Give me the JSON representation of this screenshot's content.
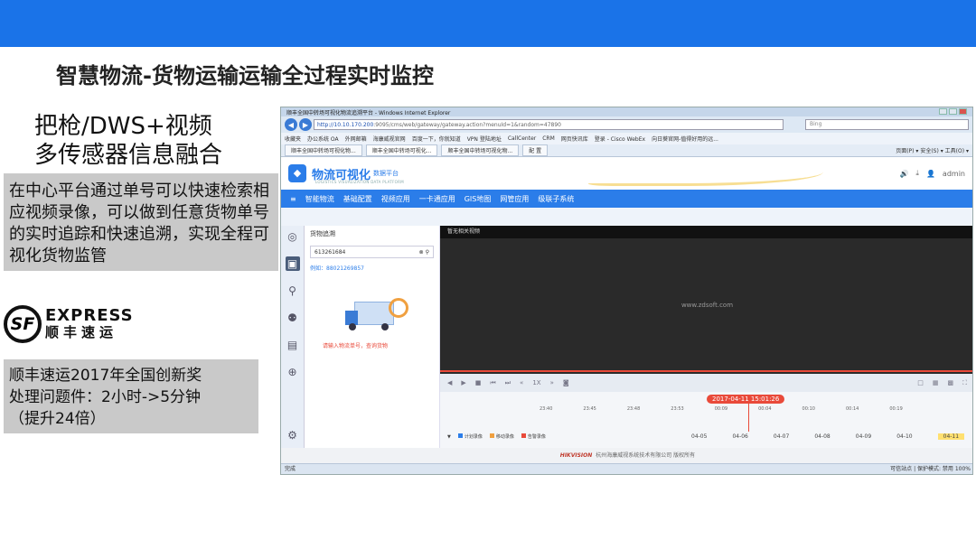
{
  "slide": {
    "title": "智慧物流-货物运输运输全过程实时监控",
    "heading_line1": "把枪/DWS+视频",
    "heading_line2": "多传感器信息融合",
    "description": "在中心平台通过单号可以快速检索相应视频录像，可以做到任意货物单号的实时追踪和快速追溯，实现全程可视化货物监管",
    "award_line1": "顺丰速运2017年全国创新奖",
    "award_line2": "处理问题件：2小时->5分钟",
    "award_line3": "（提升24倍）",
    "logo_mark": "SF",
    "logo_en": "EXPRESS",
    "logo_cn": "顺丰速运",
    "colors": {
      "topbar": "#1a73e8",
      "gray_box": "#c9c9c9"
    }
  },
  "browser": {
    "window_title": "顺丰全国中转场可视化物流追溯平台 - Windows Internet Explorer",
    "address_host": "http://10.10.170.200",
    "address_path": ":9095/cms/web/gateway/gateway.action?menuId=1&random=47890",
    "search_placeholder": "Bing",
    "favorites": [
      "收藏夹",
      "办公系统 OA",
      "外网邮箱",
      "海康威视官网",
      "百度一下，你就知道",
      "VPN 登陆地址",
      "CallCenter",
      "CRM",
      "网页快讯库",
      "登录 - Cisco WebEx",
      "向日葵官网-值得好用的远..."
    ],
    "tabs": [
      "顺丰全国中转场可视化物...",
      "顺丰全国中转场可视化...",
      "顺丰全国中转场可视化物...",
      "配 置"
    ],
    "tab_tools": "页面(P) ▾  安全(S) ▾  工具(O) ▾",
    "status_left": "完成",
    "status_right": "可信站点 | 保护模式: 禁用    100%"
  },
  "app": {
    "name": "物流可视化",
    "sub": "数据平台",
    "name_en": "LOGISTICS VISUALIZATION DATA PLATFORM",
    "user": "admin",
    "menu": [
      "智能物流",
      "基础配置",
      "视频应用",
      "一卡通应用",
      "GIS地图",
      "网管应用",
      "级联子系统"
    ],
    "panel_title": "货物追溯",
    "search_value": "613261684",
    "example": "例如：88021269857",
    "hint": "请输入物流单号，查询货物",
    "video_label": "暂无相关视频",
    "watermark": "www.zdsoft.com",
    "speed": "1X",
    "timeline_date": "2017-04-11 15:01:26",
    "times": [
      "23:40",
      "23:45",
      "23:48",
      "23:53",
      "00:09",
      "00:04",
      "00:10",
      "00:14",
      "00:19"
    ],
    "legend": [
      "计划录像",
      "移动录像",
      "告警录像"
    ],
    "legend_colors": [
      "#2b7de9",
      "#f0a040",
      "#e94a3a"
    ],
    "dates": [
      "04-05",
      "04-06",
      "04-07",
      "04-08",
      "04-09",
      "04-10",
      "04-11"
    ],
    "footer_brand": "HIKVISION",
    "footer_text": "杭州海康威视系统技术有限公司 版权所有"
  }
}
